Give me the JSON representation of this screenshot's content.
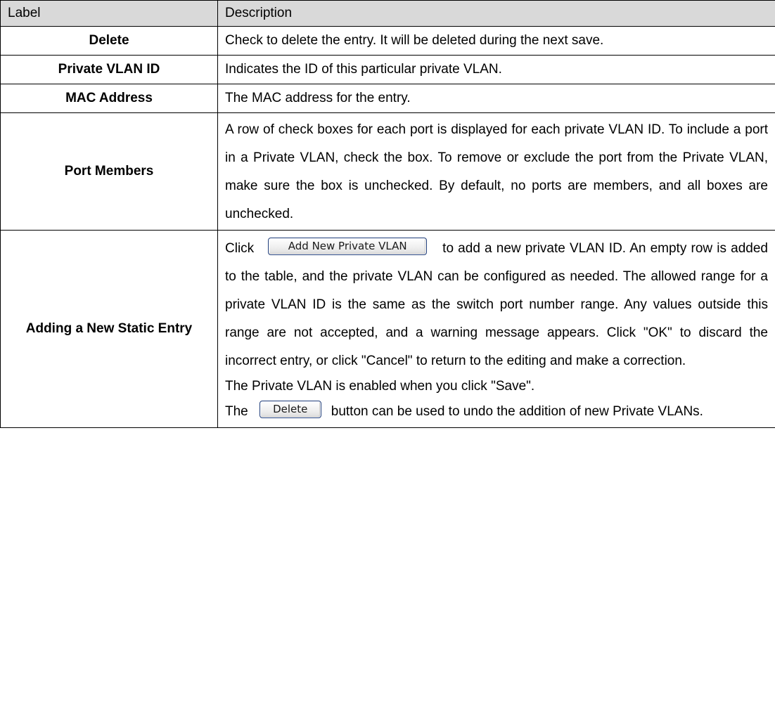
{
  "header": {
    "label": "Label",
    "description": "Description"
  },
  "rows": [
    {
      "label": "Delete",
      "description": "Check to delete the entry. It will be deleted during the next save."
    },
    {
      "label": "Private VLAN ID",
      "description": "Indicates the ID of this particular private VLAN."
    },
    {
      "label": "MAC Address",
      "description": "The MAC address for the entry."
    },
    {
      "label": "Port Members",
      "description": "A row of check boxes for each port is displayed for each private VLAN ID. To include a port in a Private VLAN, check the box. To remove or exclude the port from the Private VLAN, make sure the box is unchecked. By default, no ports are members, and all boxes are unchecked."
    },
    {
      "label": "Adding a New Static Entry",
      "click_prefix": "Click",
      "add_button_label": "Add New Private VLAN",
      "para1_after_button": "to add a new private VLAN ID. An empty row is added to the table, and the private VLAN can be configured as needed. The allowed range for a private VLAN ID is the same as the switch port number range. Any values outside this range are not accepted, and a warning message appears. Click \"OK\" to discard the incorrect entry, or click \"Cancel\" to return to the editing and make a correction.",
      "para2": "The Private VLAN is enabled when you click \"Save\".",
      "the_prefix": "The",
      "delete_button_label": "Delete",
      "para3_after_button": "button can be used to undo the addition of new Private VLANs."
    }
  ]
}
